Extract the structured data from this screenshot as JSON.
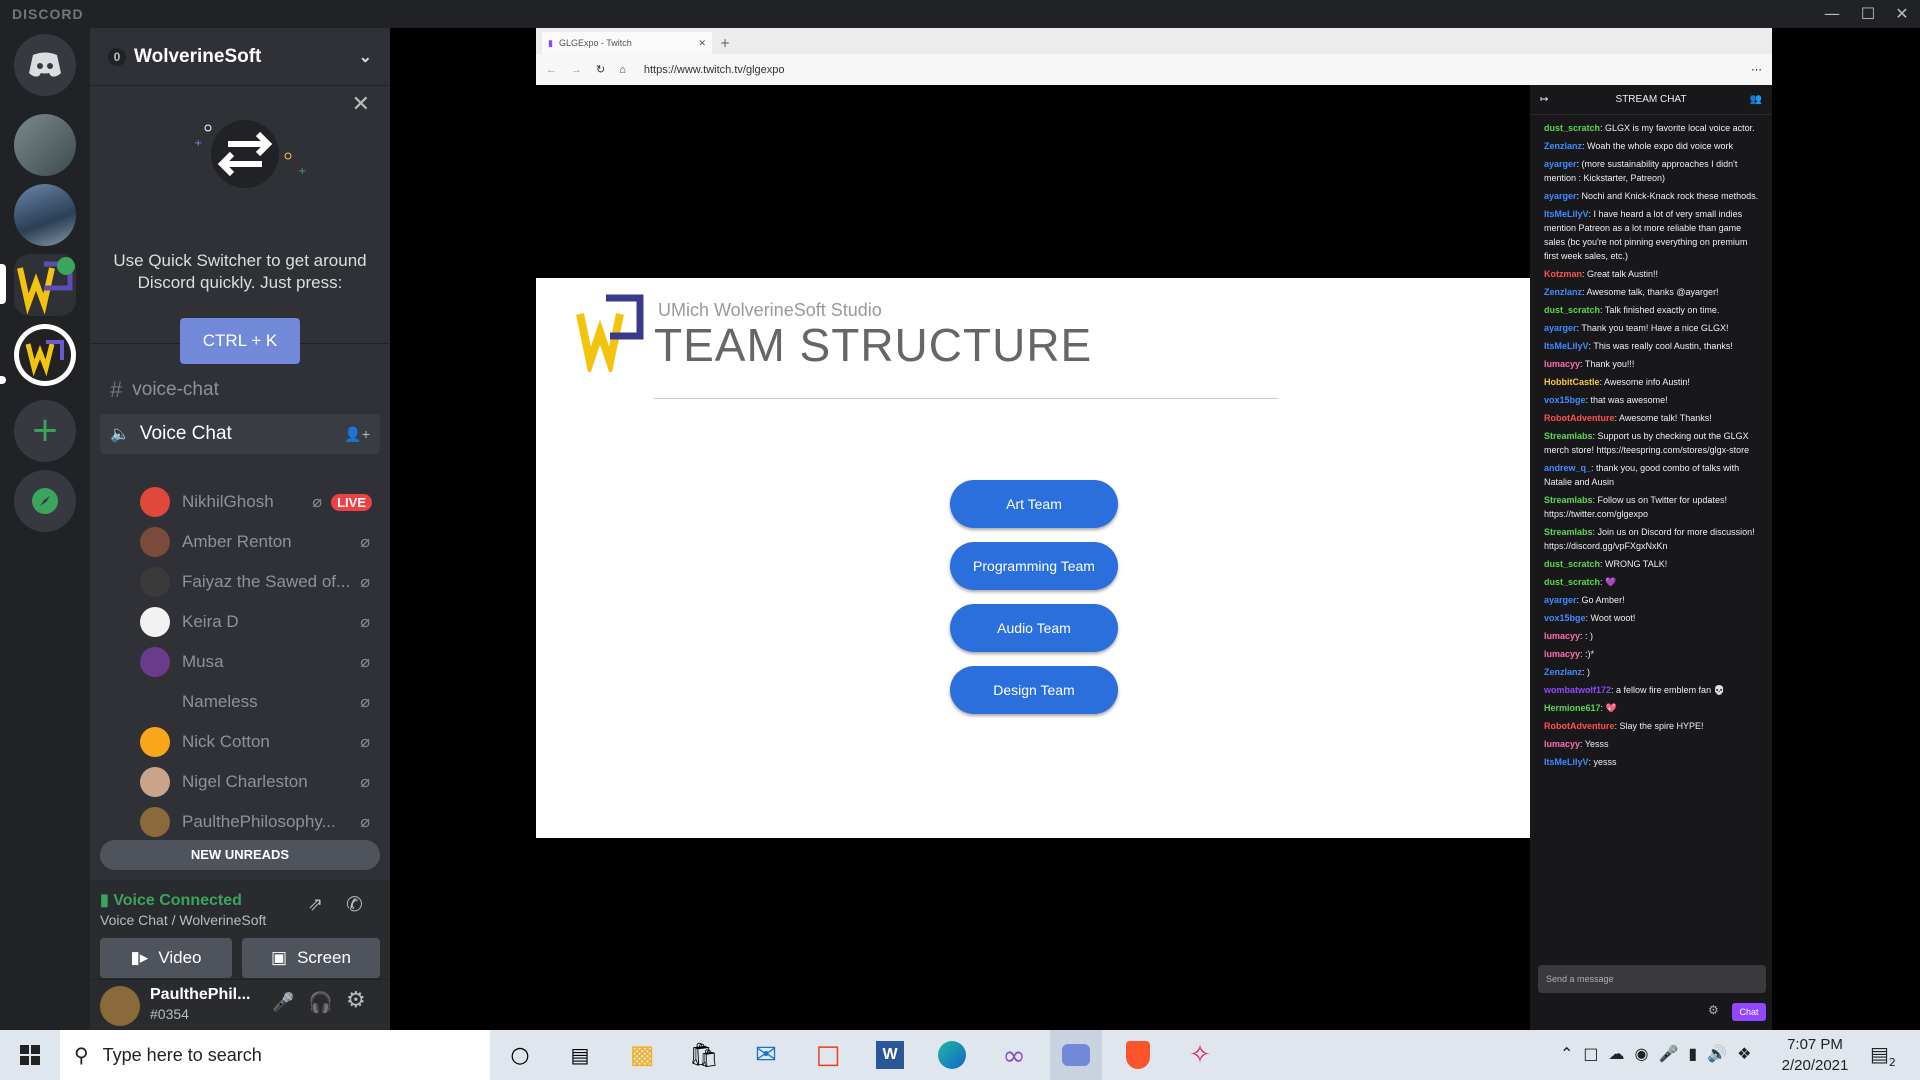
{
  "app": {
    "brand": "DISCORD"
  },
  "server": {
    "name": "WolverineSoft",
    "badge": "0"
  },
  "quick_switcher": {
    "text": "Use Quick Switcher to get around Discord quickly. Just press:",
    "shortcut": "CTRL + K"
  },
  "channels": {
    "text_channel": "voice-chat",
    "voice_channel": "Voice Chat"
  },
  "members": [
    {
      "name": "NikhilGhosh",
      "live": "LIVE",
      "color": "#e0483b"
    },
    {
      "name": "Amber Renton",
      "color": "#7a4a3a"
    },
    {
      "name": "Faiyaz the Sawed of...",
      "color": "#3a3a3a"
    },
    {
      "name": "Keira D",
      "color": "#f2f2f2"
    },
    {
      "name": "Musa",
      "color": "#6a3b8a"
    },
    {
      "name": "Nameless",
      "color": "#2f3136"
    },
    {
      "name": "Nick Cotton",
      "color": "#faa61a"
    },
    {
      "name": "Nigel Charleston",
      "color": "#c9a48a"
    },
    {
      "name": "PaulthePhilosophy...",
      "color": "#8a6a3a"
    }
  ],
  "new_unreads": "NEW UNREADS",
  "voice": {
    "status": "Voice Connected",
    "location": "Voice Chat / WolverineSoft",
    "video": "Video",
    "screen": "Screen"
  },
  "user": {
    "name": "PaulthePhil...",
    "tag": "#0354"
  },
  "browser": {
    "tab_title": "GLGExpo - Twitch",
    "url": "https://www.twitch.tv/glgexpo"
  },
  "slide": {
    "subtitle": "UMich WolverineSoft Studio",
    "title": "TEAM STRUCTURE",
    "buttons": [
      "Art Team",
      "Programming Team",
      "Audio Team",
      "Design Team"
    ]
  },
  "chat": {
    "header": "STREAM CHAT",
    "placeholder": "Send a message",
    "send": "Chat",
    "messages": [
      {
        "user": "dust_scratch",
        "text": "GLGX is my favorite local voice actor.",
        "color": "#5bd64f"
      },
      {
        "user": "Zenzlanz",
        "text": "Woah the whole expo did voice work",
        "color": "#3f8cff"
      },
      {
        "user": "ayarger",
        "text": "(more sustainability approaches I didn't mention : Kickstarter, Patreon)",
        "color": "#3f8cff"
      },
      {
        "user": "ayarger",
        "text": "Nochi and Knick-Knack rock these methods.",
        "color": "#3f8cff"
      },
      {
        "user": "ItsMeLilyV",
        "text": "I have heard a lot of very small indies mention Patreon as a lot more reliable than game sales (bc you're not pinning everything on premium first week sales, etc.)",
        "color": "#3f8cff"
      },
      {
        "user": "Kotzman",
        "text": "Great talk Austin!!",
        "color": "#ff4f4f"
      },
      {
        "user": "Zenzlanz",
        "text": "Awesome talk, thanks @ayarger!",
        "color": "#3f8cff"
      },
      {
        "user": "dust_scratch",
        "text": "Talk finished exactly on time.",
        "color": "#5bd64f"
      },
      {
        "user": "ayarger",
        "text": "Thank you team! Have a nice GLGX!",
        "color": "#3f8cff"
      },
      {
        "user": "ItsMeLilyV",
        "text": "This was really cool Austin, thanks!",
        "color": "#3f8cff"
      },
      {
        "user": "lumacyy",
        "text": "Thank you!!!",
        "color": "#ff6bb5"
      },
      {
        "user": "HobbitCastle",
        "text": "Awesome info Austin!",
        "color": "#f5c542"
      },
      {
        "user": "vox15bge",
        "text": "that was awesome!",
        "color": "#3f8cff"
      },
      {
        "user": "RobotAdventure",
        "text": "Awesome talk! Thanks!",
        "color": "#ff4f4f"
      },
      {
        "user": "Streamlabs",
        "text": "Support us by checking out the GLGX merch store! https://teespring.com/stores/glgx-store",
        "color": "#5bd64f"
      },
      {
        "user": "andrew_q_",
        "text": "thank you, good combo of talks with Natalie and Ausin",
        "color": "#3f8cff"
      },
      {
        "user": "Streamlabs",
        "text": "Follow us on Twitter for updates! https://twitter.com/glgexpo",
        "color": "#5bd64f"
      },
      {
        "user": "Streamlabs",
        "text": "Join us on Discord for more discussion! https://discord.gg/vpFXgxNxKn",
        "color": "#5bd64f"
      },
      {
        "user": "dust_scratch",
        "text": "WRONG TALK!",
        "color": "#5bd64f"
      },
      {
        "user": "dust_scratch",
        "text": "💜",
        "color": "#5bd64f"
      },
      {
        "user": "ayarger",
        "text": "Go Amber!",
        "color": "#3f8cff"
      },
      {
        "user": "vox15bge",
        "text": "Woot woot!",
        "color": "#3f8cff"
      },
      {
        "user": "lumacyy",
        "text": ": )",
        "color": "#ff6bb5"
      },
      {
        "user": "lumacyy",
        "text": ":)*",
        "color": "#ff6bb5"
      },
      {
        "user": "Zenzlanz",
        "text": ")",
        "color": "#3f8cff"
      },
      {
        "user": "wombatwolf172",
        "text": "a fellow fire emblem fan 💀",
        "color": "#9147ff"
      },
      {
        "user": "Hermione617",
        "text": "💖",
        "color": "#5bd64f"
      },
      {
        "user": "RobotAdventure",
        "text": "Slay the spire HYPE!",
        "color": "#ff4f4f"
      },
      {
        "user": "lumacyy",
        "text": "Yesss",
        "color": "#ff6bb5"
      },
      {
        "user": "ItsMeLilyV",
        "text": "yesss",
        "color": "#3f8cff"
      }
    ]
  },
  "taskbar": {
    "search_placeholder": "Type here to search",
    "time": "7:07 PM",
    "date": "2/20/2021",
    "notifications": "2"
  }
}
